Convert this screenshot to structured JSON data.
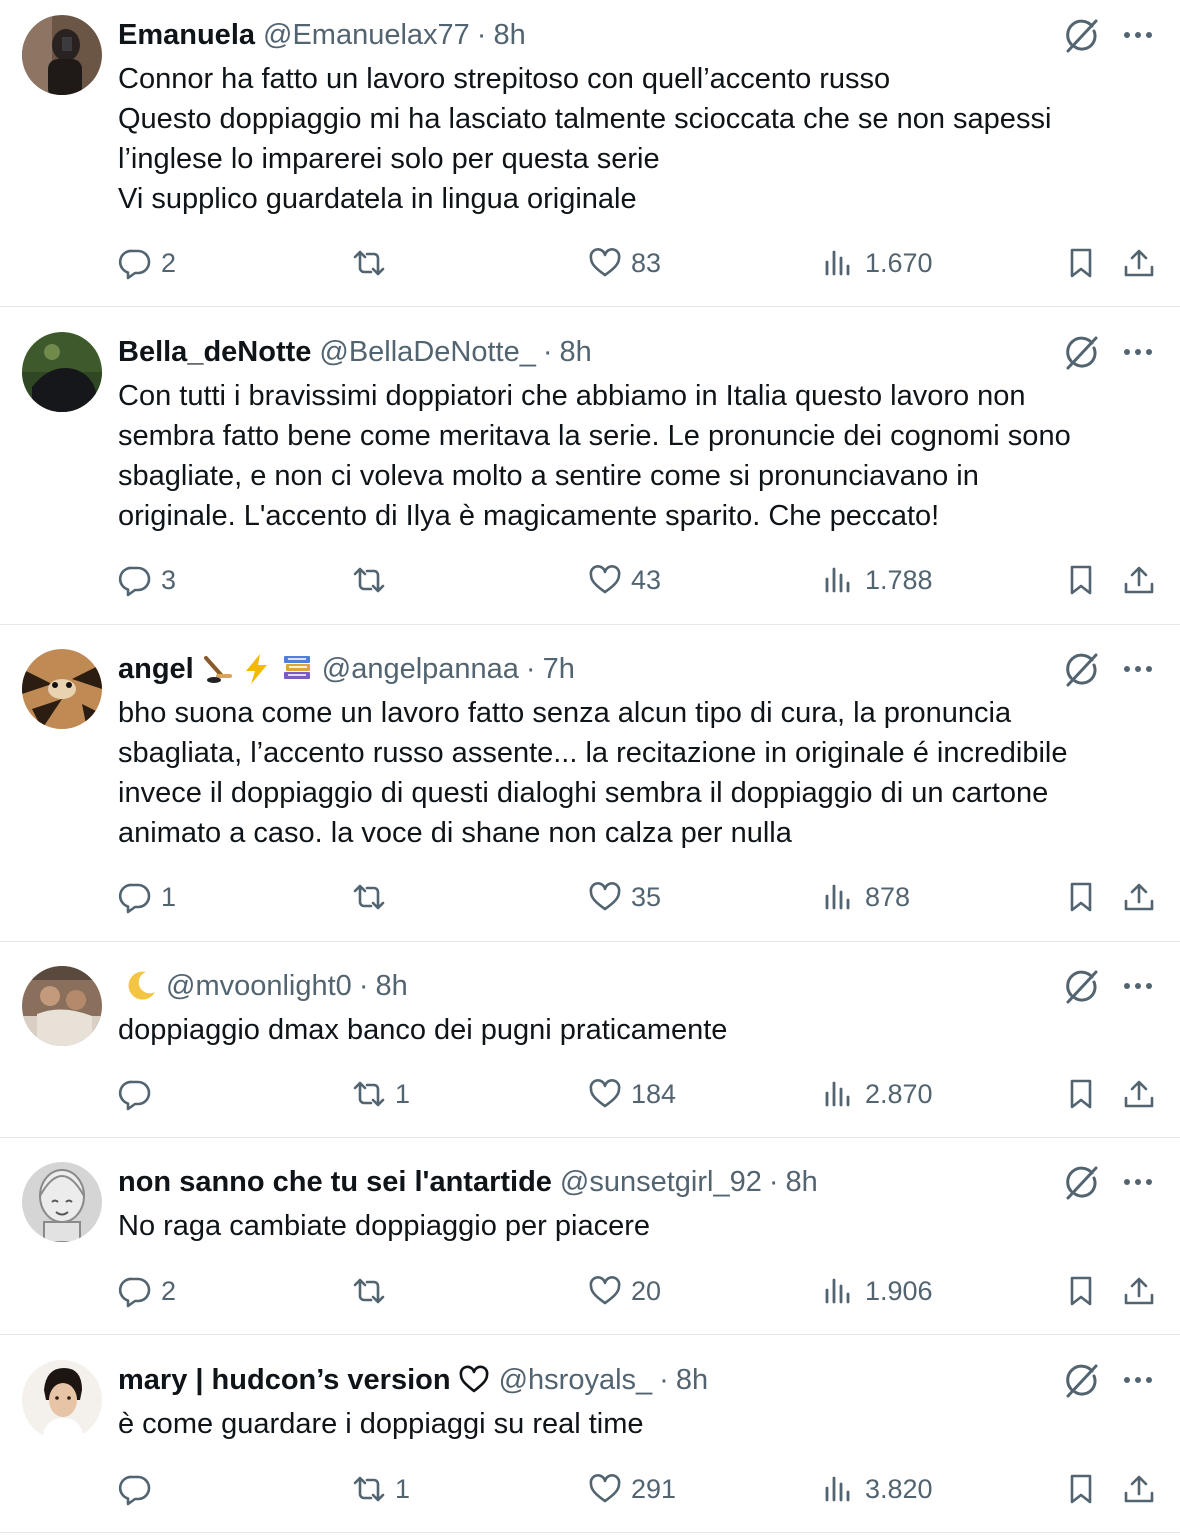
{
  "colors": {
    "text": "#0f1419",
    "secondary": "#536471",
    "divider": "#e6e9ec"
  },
  "tweets": [
    {
      "name": "Emanuela",
      "name_emojis": [],
      "handle": "@Emanuelax77",
      "time": "8h",
      "lines": [
        "Connor ha fatto un lavoro strepitoso con quell’accento russo",
        "Questo doppiaggio mi ha lasciato talmente scioccata che se non sapessi",
        "l’inglese lo imparerei solo per questa serie",
        "Vi supplico guardatela in lingua originale"
      ],
      "replies": "2",
      "retweets": "",
      "likes": "83",
      "views": "1.670"
    },
    {
      "name": "Bella_deNotte",
      "name_emojis": [],
      "handle": "@BellaDeNotte_",
      "time": "8h",
      "lines": [
        "Con tutti i bravissimi doppiatori che abbiamo in Italia questo lavoro non",
        "sembra fatto bene come meritava la serie. Le pronuncie dei cognomi sono",
        "sbagliate, e non ci voleva molto a sentire come si pronunciavano in",
        "originale. L'accento di Ilya è magicamente sparito. Che peccato!"
      ],
      "replies": "3",
      "retweets": "",
      "likes": "43",
      "views": "1.788"
    },
    {
      "name": "angel",
      "name_emojis": [
        "hockey-emoji",
        "lightning-emoji",
        "books-emoji"
      ],
      "handle": "@angelpannaa",
      "time": "7h",
      "lines": [
        "bho suona come un lavoro fatto senza alcun tipo di cura, la pronuncia",
        "sbagliata, l’accento russo assente... la recitazione in originale é incredibile",
        "invece il doppiaggio di questi dialoghi sembra il doppiaggio di un cartone",
        "animato a caso. la voce di shane non calza per nulla"
      ],
      "replies": "1",
      "retweets": "",
      "likes": "35",
      "views": "878"
    },
    {
      "name": "",
      "name_emojis": [
        "moon-emoji"
      ],
      "handle": "@mvoonlight0",
      "time": "8h",
      "lines": [
        "doppiaggio dmax banco dei pugni praticamente"
      ],
      "replies": "",
      "retweets": "1",
      "likes": "184",
      "views": "2.870"
    },
    {
      "name": "non sanno che tu sei l'antartide",
      "name_emojis": [],
      "handle": "@sunsetgirl_92",
      "time": "8h",
      "lines": [
        "No raga cambiate doppiaggio per piacere"
      ],
      "replies": "2",
      "retweets": "",
      "likes": "20",
      "views": "1.906"
    },
    {
      "name": "mary | hudcon’s version",
      "name_emojis": [
        "heart-outline-emoji"
      ],
      "handle": "@hsroyals_",
      "time": "8h",
      "lines": [
        "è come guardare i doppiaggi su real time"
      ],
      "replies": "",
      "retweets": "1",
      "likes": "291",
      "views": "3.820"
    }
  ]
}
